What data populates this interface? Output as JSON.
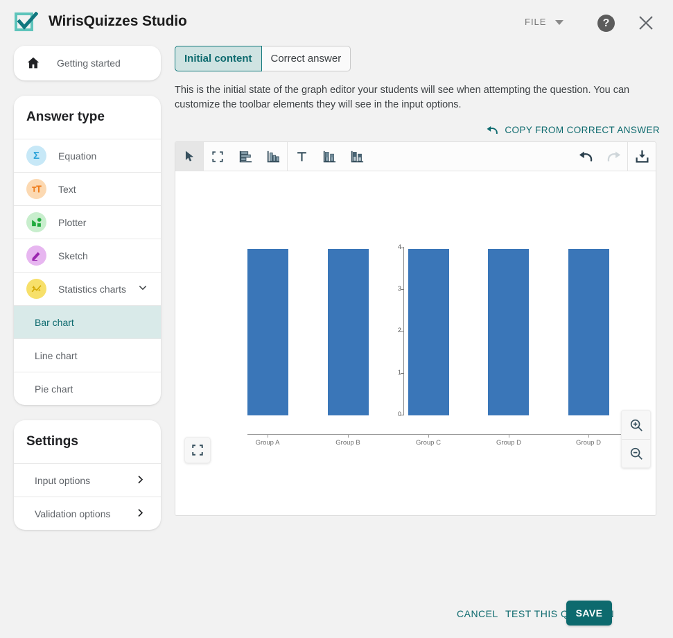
{
  "header": {
    "logo_icon": "checkbox-check-icon",
    "title": "WirisQuizzes Studio",
    "file_label": "FILE",
    "file_caret_icon": "caret-down-icon",
    "help_label": "?",
    "help_icon": "help-circle-icon",
    "close_icon": "close-icon"
  },
  "sidebar": {
    "getting_started": {
      "label": "Getting started",
      "icon": "home-icon"
    },
    "answer_type": {
      "title": "Answer type",
      "items": [
        {
          "label": "Equation",
          "icon": "sigma-icon",
          "bg": "#c7e8f7",
          "fg": "#2ea3d9",
          "glyph": "Σ"
        },
        {
          "label": "Text",
          "icon": "text-format-icon",
          "bg": "#fcd9b2",
          "fg": "#ef7d1c",
          "glyph": "τT"
        },
        {
          "label": "Plotter",
          "icon": "plotter-icon",
          "bg": "#c8eecd",
          "fg": "#1faa3c",
          "glyph": ""
        },
        {
          "label": "Sketch",
          "icon": "pencil-icon",
          "bg": "#e7b6f0",
          "fg": "#9c27b0",
          "glyph": ""
        },
        {
          "label": "Statistics charts",
          "icon": "statistics-sparkle-icon",
          "bg": "#f7e06a",
          "fg": "#d3a800",
          "glyph": "",
          "chevron": "chevron-down-icon",
          "expanded": true
        }
      ],
      "sub_items": [
        {
          "label": "Bar chart",
          "active": true
        },
        {
          "label": "Line chart",
          "active": false
        },
        {
          "label": "Pie chart",
          "active": false
        }
      ]
    },
    "settings": {
      "title": "Settings",
      "items": [
        {
          "label": "Input options",
          "chevron": "chevron-right-icon"
        },
        {
          "label": "Validation options",
          "chevron": "chevron-right-icon"
        }
      ]
    }
  },
  "main": {
    "tabs": [
      {
        "label": "Initial content",
        "active": true
      },
      {
        "label": "Correct answer",
        "active": false
      }
    ],
    "description": "This is the initial state of the graph editor your students will see when attempting the question. You can customize the toolbar elements they will see in the input options.",
    "copy_link": {
      "label": "COPY FROM CORRECT ANSWER",
      "icon": "undo-arrow-icon"
    },
    "toolbar": {
      "left_tools": [
        {
          "name": "select-pointer-tool",
          "selected": true
        },
        {
          "name": "fit-to-screen-tool",
          "selected": false
        },
        {
          "name": "horizontal-bar-chart-tool",
          "selected": false
        },
        {
          "name": "vertical-bar-chart-tool",
          "selected": false
        }
      ],
      "mid_tools": [
        {
          "name": "text-tool",
          "selected": false
        },
        {
          "name": "grouped-bar-chart-tool",
          "selected": false
        },
        {
          "name": "stacked-bar-chart-tool",
          "selected": false
        }
      ],
      "right_tools": [
        {
          "name": "undo-tool",
          "enabled": true
        },
        {
          "name": "redo-tool",
          "enabled": false
        },
        {
          "name": "download-tool",
          "enabled": true
        }
      ]
    },
    "canvas_controls": {
      "fit_icon": "fit-to-screen-icon",
      "zoom_in_icon": "zoom-in-icon",
      "zoom_out_icon": "zoom-out-icon"
    }
  },
  "footer": {
    "cancel_label": "CANCEL",
    "test_label": "TEST THIS QUESTION",
    "save_label": "SAVE"
  },
  "colors": {
    "accent": "#0d6a6e",
    "bar": "#3a76b8",
    "active_tab_bg": "#cfe3e2",
    "active_sub_bg": "#d9eae9"
  },
  "chart_data": {
    "type": "bar",
    "title": "",
    "xlabel": "",
    "ylabel": "",
    "categories": [
      "Group A",
      "Group B",
      "Group C",
      "Group D",
      "Group D"
    ],
    "values": [
      3.95,
      3.95,
      3.95,
      3.95,
      3.95
    ],
    "ylim": [
      0,
      4
    ],
    "yticks": [
      0,
      1,
      2,
      3,
      4
    ],
    "ytick_labels": [
      "0",
      "1",
      "2",
      "3",
      "4"
    ],
    "grid": false,
    "legend": false,
    "bar_color": "#3a76b8"
  }
}
